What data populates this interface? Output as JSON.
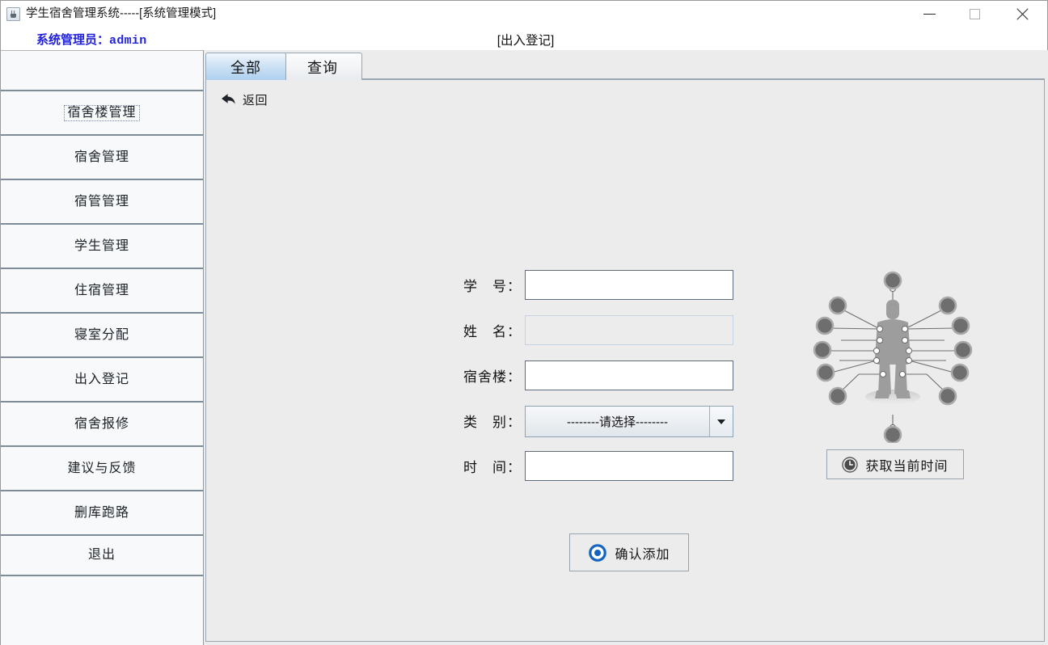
{
  "window": {
    "title": "学生宿舍管理系统-----[系统管理模式]",
    "app_icon": "java-coffee-cup-icon",
    "controls": {
      "minimize": "minimize-icon",
      "maximize": "maximize-icon",
      "close": "close-icon"
    }
  },
  "header": {
    "admin_prefix": "系统管理员：",
    "admin_user": "admin",
    "admin_color": "#2222dd",
    "page_title": "[出入登记]"
  },
  "sidebar": {
    "items": [
      {
        "label": "宿舍楼管理",
        "focused": true
      },
      {
        "label": "宿舍管理",
        "focused": false
      },
      {
        "label": "宿管管理",
        "focused": false
      },
      {
        "label": "学生管理",
        "focused": false
      },
      {
        "label": "住宿管理",
        "focused": false
      },
      {
        "label": "寝室分配",
        "focused": false
      },
      {
        "label": "出入登记",
        "focused": false
      },
      {
        "label": "宿舍报修",
        "focused": false
      },
      {
        "label": "建议与反馈",
        "focused": false
      },
      {
        "label": "删库跑路",
        "focused": false
      },
      {
        "label": "退出",
        "focused": false
      }
    ]
  },
  "main": {
    "tabs": [
      {
        "label": "全部",
        "selected": true
      },
      {
        "label": "查询",
        "selected": false
      }
    ],
    "selected_tab_color": "#aed0ee",
    "back": {
      "icon": "back-arrow-icon",
      "label": "返回"
    },
    "form": {
      "fields": [
        {
          "label": "学　号：",
          "value": "",
          "placeholder": "",
          "type": "text",
          "disabled": false
        },
        {
          "label": "姓　名：",
          "value": "",
          "placeholder": "",
          "type": "text",
          "disabled": true
        },
        {
          "label": "宿舍楼：",
          "value": "",
          "placeholder": "",
          "type": "text",
          "disabled": false
        },
        {
          "label": "类　别：",
          "value": "--------请选择--------",
          "type": "select",
          "disabled": false
        },
        {
          "label": "时　间：",
          "value": "",
          "placeholder": "",
          "type": "text",
          "disabled": false
        }
      ]
    },
    "illustration": {
      "name": "person-network-illustration",
      "body_color": "#9a9a9a",
      "node_color": "#6e6e6e"
    },
    "buttons": {
      "get_time": {
        "label": "获取当前时间",
        "icon": "clock-icon"
      },
      "confirm": {
        "label": "确认添加",
        "icon": "target-circle-icon",
        "icon_color": "#1564c0"
      }
    }
  }
}
